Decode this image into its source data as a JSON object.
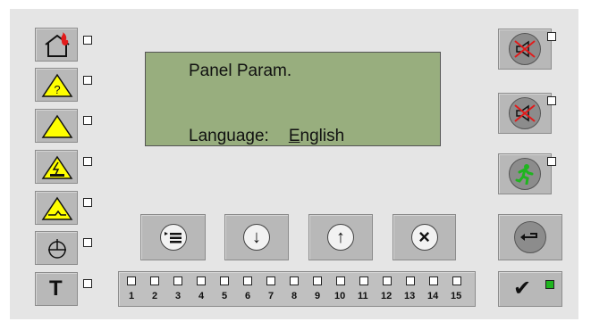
{
  "display": {
    "line1": "Panel Param.",
    "line2_label": "Language:",
    "line2_value_first": "E",
    "line2_value_rest": "nglish"
  },
  "left_indicators": [
    {
      "icon": "house-fire-icon"
    },
    {
      "icon": "warning-question-icon"
    },
    {
      "icon": "warning-icon"
    },
    {
      "icon": "electrical-fault-icon"
    },
    {
      "icon": "ground-fault-icon"
    },
    {
      "icon": "power-icon"
    },
    {
      "icon": "test-icon",
      "glyph": "T"
    }
  ],
  "nav_buttons": [
    {
      "icon": "menu-icon"
    },
    {
      "icon": "arrow-down-icon",
      "glyph": "↓"
    },
    {
      "icon": "arrow-up-icon",
      "glyph": "↑"
    },
    {
      "icon": "cancel-icon",
      "glyph": "×"
    }
  ],
  "right_buttons": [
    {
      "icon": "mute-buzzer-icon"
    },
    {
      "icon": "mute-sounder-icon"
    },
    {
      "icon": "evacuate-icon"
    },
    {
      "icon": "back-icon"
    },
    {
      "icon": "confirm-icon",
      "glyph": "✔"
    }
  ],
  "zones": [
    "1",
    "2",
    "3",
    "4",
    "5",
    "6",
    "7",
    "8",
    "9",
    "10",
    "11",
    "12",
    "13",
    "14",
    "15"
  ],
  "colors": {
    "lcd": "#98ae7e",
    "led_on": "#1fb51f",
    "warning": "#ffff00",
    "fire": "#e21b1b"
  }
}
